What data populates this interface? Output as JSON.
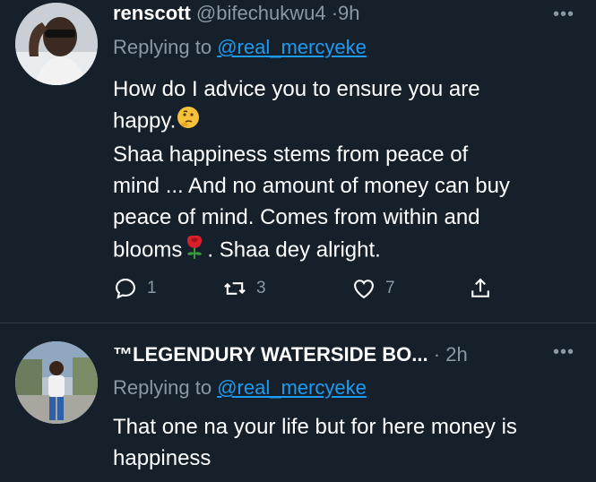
{
  "tweets": [
    {
      "name": "renscott",
      "handle": "@bifechukwu4",
      "separator": "·",
      "time": "9h",
      "replying_prefix": "Replying to",
      "replying_to": "@real_mercyeke",
      "lines": [
        "How do I advice you to ensure you are",
        "happy.",
        "Shaa happiness stems from peace of",
        "mind ... And no amount of money can buy",
        "peace of mind. Comes from within and",
        "blooms",
        ". Shaa dey alright."
      ],
      "actions": {
        "reply_icon": "reply-icon",
        "reply_count": "1",
        "retweet_icon": "retweet-icon",
        "retweet_count": "3",
        "like_icon": "heart-icon",
        "like_count": "7",
        "share_icon": "share-icon"
      },
      "emojis": [
        "thinking-face",
        "rose"
      ]
    },
    {
      "name": "™LEGENDURY WATERSIDE BO...",
      "separator": "·",
      "time": "2h",
      "replying_prefix": "Replying to",
      "replying_to": "@real_mercyeke",
      "lines": [
        "That one na your life but for here money is",
        "happiness"
      ]
    }
  ],
  "more_label": "•••",
  "colors": {
    "background": "#15202b",
    "link": "#1d9bf0",
    "muted": "#8b98a5"
  }
}
